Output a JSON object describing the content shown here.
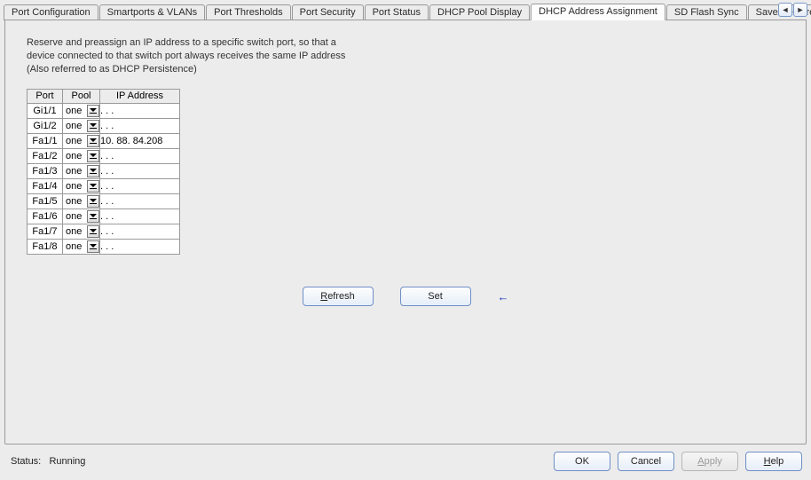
{
  "tabs": [
    "Port Configuration",
    "Smartports & VLANs",
    "Port Thresholds",
    "Port Security",
    "Port Status",
    "DHCP Pool Display",
    "DHCP Address Assignment",
    "SD Flash Sync",
    "Save/Restore"
  ],
  "active_tab_index": 6,
  "scroll_left": "◄",
  "scroll_right": "►",
  "description": "Reserve and preassign an IP address to a specific switch port, so that a device connected to that switch port always receives the same IP address (Also referred to as DHCP Persistence)",
  "table": {
    "headers": {
      "port": "Port",
      "pool": "Pool",
      "ip": "IP Address"
    },
    "rows": [
      {
        "port": "Gi1/1",
        "pool": "one",
        "ip": " .  .  ."
      },
      {
        "port": "Gi1/2",
        "pool": "one",
        "ip": " .  .  ."
      },
      {
        "port": "Fa1/1",
        "pool": "one",
        "ip": "10. 88. 84.208"
      },
      {
        "port": "Fa1/2",
        "pool": "one",
        "ip": " .  .  ."
      },
      {
        "port": "Fa1/3",
        "pool": "one",
        "ip": " .  .  ."
      },
      {
        "port": "Fa1/4",
        "pool": "one",
        "ip": " .  .  ."
      },
      {
        "port": "Fa1/5",
        "pool": "one",
        "ip": " .  .  ."
      },
      {
        "port": "Fa1/6",
        "pool": "one",
        "ip": " .  .  ."
      },
      {
        "port": "Fa1/7",
        "pool": "one",
        "ip": " .  .  ."
      },
      {
        "port": "Fa1/8",
        "pool": "one",
        "ip": " .  .  ."
      }
    ]
  },
  "buttons": {
    "refresh_underline": "R",
    "refresh_rest": "efresh",
    "set": "Set",
    "ok": "OK",
    "cancel": "Cancel",
    "apply_underline": "A",
    "apply_rest": "pply",
    "help_underline": "H",
    "help_rest": "elp"
  },
  "arrow_indicator": "←",
  "status_label": "Status:",
  "status_value": "Running"
}
